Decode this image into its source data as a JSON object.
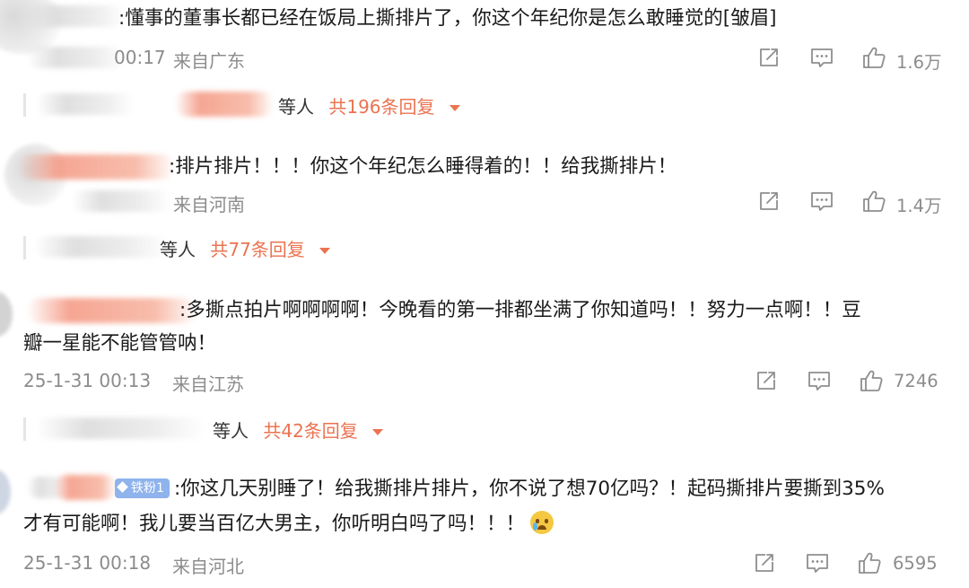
{
  "actions": {
    "share_icon": "share-icon",
    "reply_icon": "reply-icon",
    "like_icon": "like-icon"
  },
  "reply_caret_color": "#eb7350",
  "comments": [
    {
      "text": ":懂事的董事长都已经在饭局上撕排片了，你这个年纪你是怎么敢睡觉的[皱眉]",
      "time": "00:17",
      "location": "来自广东",
      "likes": "1.6万",
      "reply_who": "等人",
      "reply_total": "共196条回复"
    },
    {
      "text": ":排片排片！！！你这个年纪怎么睡得着的！！给我撕排片！",
      "time": "",
      "location": "来自河南",
      "likes": "1.4万",
      "reply_who": "等人",
      "reply_total": "共77条回复"
    },
    {
      "text_line1": ":多撕点拍片啊啊啊啊！今晚看的第一排都坐满了你知道吗！！努力一点啊！！豆",
      "text_line2": "瓣一星能不能管管呐！",
      "time": "25-1-31 00:13",
      "location": "来自江苏",
      "likes": "7246",
      "reply_who": "等人",
      "reply_total": "共42条回复"
    },
    {
      "badge": "铁粉1",
      "text_line1": ":你这几天别睡了！给我撕排片排片，你不说了想70亿吗？！起码撕排片要撕到35%",
      "text_line2": "才有可能啊！我儿要当百亿大男主，你听明白吗了吗！！！",
      "emoji": "crying-face-emoji",
      "time": "25-1-31 00:18",
      "location": "来自河北",
      "likes": "6595"
    }
  ]
}
